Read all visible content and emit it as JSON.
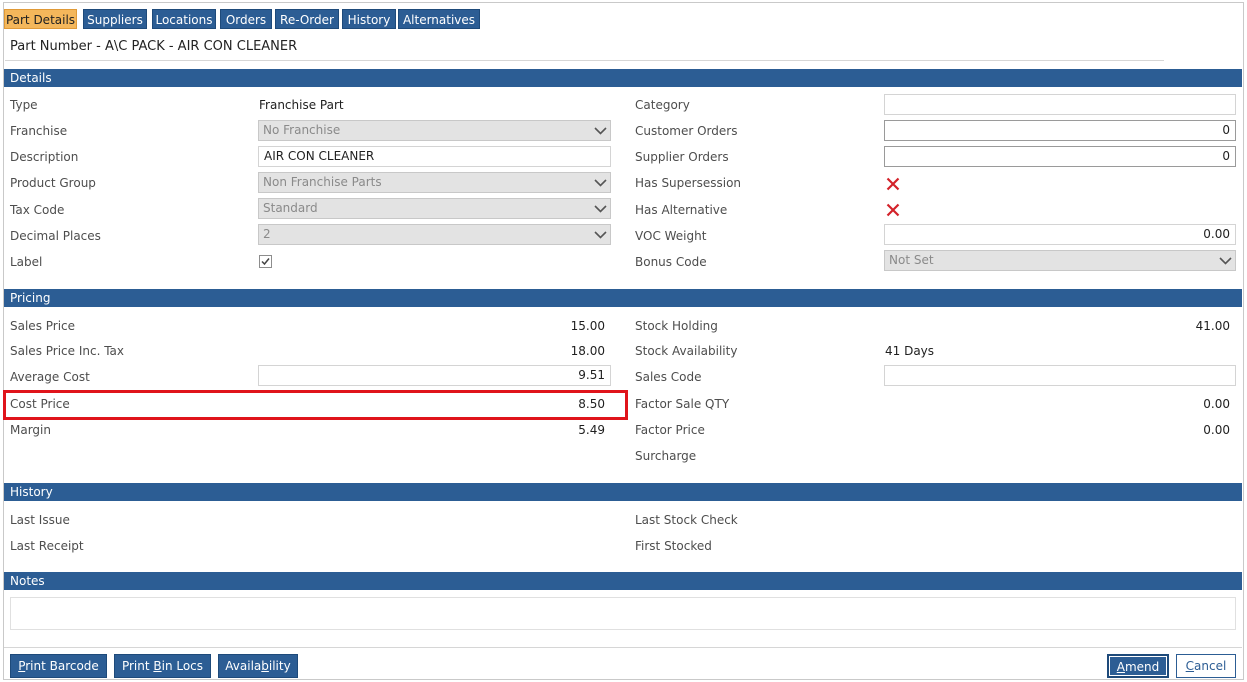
{
  "tabs": [
    "Part Details",
    "Suppliers",
    "Locations",
    "Orders",
    "Re-Order",
    "History",
    "Alternatives"
  ],
  "title": "Part Number - A\\C PACK - AIR CON CLEANER",
  "sections": {
    "details": "Details",
    "pricing": "Pricing",
    "history": "History",
    "notes": "Notes"
  },
  "details": {
    "type_label": "Type",
    "type_value": "Franchise Part",
    "franchise_label": "Franchise",
    "franchise_value": "No Franchise",
    "description_label": "Description",
    "description_value": "AIR CON CLEANER",
    "product_group_label": "Product Group",
    "product_group_value": "Non Franchise Parts",
    "tax_code_label": "Tax Code",
    "tax_code_value": "Standard",
    "decimal_places_label": "Decimal Places",
    "decimal_places_value": "2",
    "label_label": "Label",
    "label_checked": true,
    "category_label": "Category",
    "category_value": "",
    "customer_orders_label": "Customer Orders",
    "customer_orders_value": "0",
    "supplier_orders_label": "Supplier Orders",
    "supplier_orders_value": "0",
    "has_supersession_label": "Has Supersession",
    "has_supersession": false,
    "has_alternative_label": "Has Alternative",
    "has_alternative": false,
    "voc_weight_label": "VOC Weight",
    "voc_weight_value": "0.00",
    "bonus_code_label": "Bonus Code",
    "bonus_code_value": "Not Set"
  },
  "pricing": {
    "sales_price_label": "Sales Price",
    "sales_price_value": "15.00",
    "sales_price_inc_tax_label": "Sales Price Inc. Tax",
    "sales_price_inc_tax_value": "18.00",
    "average_cost_label": "Average Cost",
    "average_cost_value": "9.51",
    "cost_price_label": "Cost Price",
    "cost_price_value": "8.50",
    "margin_label": "Margin",
    "margin_value": "5.49",
    "stock_holding_label": "Stock Holding",
    "stock_holding_value": "41.00",
    "stock_availability_label": "Stock Availability",
    "stock_availability_value": "41 Days",
    "sales_code_label": "Sales Code",
    "sales_code_value": "",
    "factor_sale_qty_label": "Factor Sale QTY",
    "factor_sale_qty_value": "0.00",
    "factor_price_label": "Factor Price",
    "factor_price_value": "0.00",
    "surcharge_label": "Surcharge"
  },
  "history": {
    "last_issue_label": "Last Issue",
    "last_receipt_label": "Last Receipt",
    "last_stock_check_label": "Last Stock Check",
    "first_stocked_label": "First Stocked"
  },
  "notes": {
    "value": ""
  },
  "buttons": {
    "print_barcode_pre": "",
    "print_barcode_u": "P",
    "print_barcode_post": "rint Barcode",
    "print_bin_locs_pre": "Print ",
    "print_bin_locs_u": "B",
    "print_bin_locs_post": "in Locs",
    "availability_pre": "Availa",
    "availability_u": "b",
    "availability_post": "ility",
    "amend_pre": "",
    "amend_u": "A",
    "amend_post": "mend",
    "cancel_pre": "",
    "cancel_u": "C",
    "cancel_post": "ancel"
  },
  "colors": {
    "header_blue": "#2c5d94",
    "active_tab": "#f4b75b",
    "highlight_red": "#e0141b",
    "x_red": "#d3222a"
  },
  "icons": {
    "dropdown": "chevron-down-icon",
    "false_flag": "x-icon",
    "checkbox": "check-icon"
  }
}
